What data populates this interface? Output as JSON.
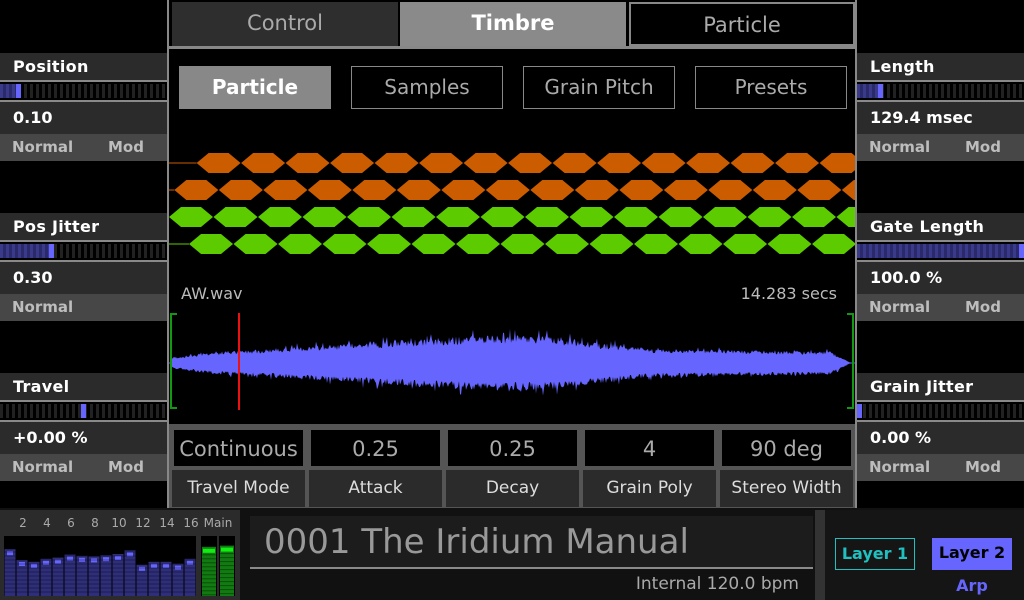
{
  "left_params": [
    {
      "name": "Position",
      "value": "0.10",
      "slider_fraction": 0.1,
      "bipolar": false,
      "modes": [
        "Normal",
        "Mod"
      ]
    },
    {
      "name": "Pos Jitter",
      "value": "0.30",
      "slider_fraction": 0.3,
      "bipolar": false,
      "modes": [
        "Normal"
      ]
    },
    {
      "name": "Travel",
      "value": "+0.00 %",
      "slider_fraction": 0.5,
      "bipolar": true,
      "modes": [
        "Normal",
        "Mod"
      ]
    }
  ],
  "right_params": [
    {
      "name": "Length",
      "value": "129.4 msec",
      "slider_fraction": 0.13,
      "bipolar": false,
      "modes": [
        "Normal",
        "Mod"
      ]
    },
    {
      "name": "Gate Length",
      "value": "100.0 %",
      "slider_fraction": 1.0,
      "bipolar": false,
      "modes": [
        "Normal",
        "Mod"
      ]
    },
    {
      "name": "Grain Jitter",
      "value": "0.00 %",
      "slider_fraction": 0.0,
      "bipolar": false,
      "modes": [
        "Normal",
        "Mod"
      ]
    }
  ],
  "top_tabs": [
    {
      "label": "Control",
      "state": "inactive"
    },
    {
      "label": "Timbre",
      "state": "active"
    },
    {
      "label": "Particle",
      "state": "outlined"
    }
  ],
  "sub_tabs": [
    {
      "label": "Particle",
      "active": true
    },
    {
      "label": "Samples",
      "active": false
    },
    {
      "label": "Grain Pitch",
      "active": false
    },
    {
      "label": "Presets",
      "active": false
    }
  ],
  "grains": {
    "colors": {
      "orange": "#cc5c00",
      "green": "#5ccc00"
    },
    "rows": [
      {
        "color": "orange",
        "offset": 0.62
      },
      {
        "color": "orange",
        "offset": 0.12
      },
      {
        "color": "green",
        "offset": 0.0
      },
      {
        "color": "green",
        "offset": 0.45
      }
    ]
  },
  "sample": {
    "filename": "AW.wav",
    "duration": "14.283 secs",
    "playhead_fraction": 0.1,
    "waveform_color": "#6666ff",
    "playhead_color": "#ee1111",
    "marker_color": "#119911"
  },
  "grain_params": [
    {
      "label": "Travel Mode",
      "value": "Continuous"
    },
    {
      "label": "Attack",
      "value": "0.25"
    },
    {
      "label": "Decay",
      "value": "0.25"
    },
    {
      "label": "Grain Poly",
      "value": "4"
    },
    {
      "label": "Stereo Width",
      "value": "90 deg"
    }
  ],
  "mixer": {
    "channel_labels": [
      "2",
      "4",
      "6",
      "8",
      "10",
      "12",
      "14",
      "16"
    ],
    "main_label": "Main",
    "channel_levels": [
      0.78,
      0.6,
      0.57,
      0.62,
      0.64,
      0.69,
      0.67,
      0.66,
      0.68,
      0.7,
      0.76,
      0.52,
      0.57,
      0.57,
      0.54,
      0.62
    ],
    "main_levels": [
      0.82,
      0.84
    ]
  },
  "patch": {
    "name": "0001 The Iridium Manual",
    "tempo": "Internal 120.0 bpm"
  },
  "layers": {
    "layer1": "Layer 1",
    "layer2": "Layer 2",
    "arp": "Arp"
  }
}
